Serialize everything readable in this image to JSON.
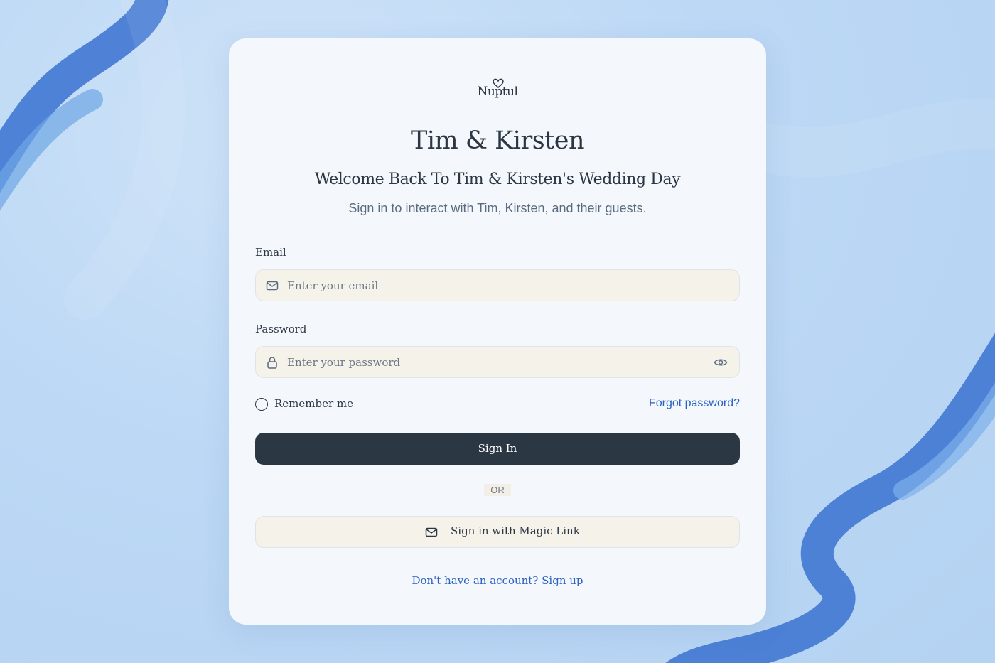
{
  "brand": {
    "name": "Nuptul"
  },
  "header": {
    "couple": "Tim & Kirsten",
    "welcome": "Welcome Back To Tim & Kirsten's Wedding Day",
    "subtitle": "Sign in to interact with Tim, Kirsten, and their guests."
  },
  "form": {
    "email_label": "Email",
    "email_placeholder": "Enter your email",
    "email_value": "",
    "password_label": "Password",
    "password_placeholder": "Enter your password",
    "password_value": "",
    "remember_label": "Remember me",
    "remember_checked": false,
    "forgot_label": "Forgot password?",
    "signin_label": "Sign In",
    "divider_label": "OR",
    "magic_label": "Sign in with Magic Link"
  },
  "footer": {
    "prompt": "Don't have an account?",
    "signup_label": "Sign up"
  },
  "icons": {
    "logo": "heart-icon",
    "email": "mail-icon",
    "password": "lock-icon",
    "toggle": "eye-icon",
    "magic": "mail-icon"
  },
  "colors": {
    "background": "#bcd8f5",
    "card": "#f4f8fd",
    "primary": "#2c3744",
    "link": "#2b62c0",
    "field": "#f5f2ea",
    "ribbon": "#3b74d4"
  }
}
